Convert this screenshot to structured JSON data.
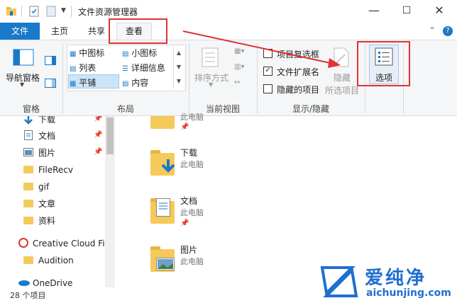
{
  "window": {
    "title": "文件资源管理器",
    "minimize": "—",
    "maximize": "☐",
    "close": "✕"
  },
  "tabs": [
    {
      "label": "文件"
    },
    {
      "label": "主页"
    },
    {
      "label": "共享"
    },
    {
      "label": "查看"
    }
  ],
  "ribbon": {
    "pane_group": {
      "label": "窗格",
      "nav_pane": "导航窗格"
    },
    "layout_group": {
      "label": "布局",
      "items": [
        "中图标",
        "小图标",
        "列表",
        "详细信息",
        "平铺",
        "内容"
      ],
      "selected": "平铺"
    },
    "current_view_group": {
      "label": "当前视图",
      "sort_by": "排序方式"
    },
    "show_hide_group": {
      "label": "显示/隐藏",
      "item_checkboxes": "项目复选框",
      "file_extensions": "文件扩展名",
      "hidden_items": "隐藏的项目",
      "hide_selected_line1": "隐藏",
      "hide_selected_line2": "所选项目"
    },
    "options": "选项",
    "help_chevron": "⌃",
    "help": "?"
  },
  "nav": {
    "items": [
      {
        "label": "下载",
        "pinned": true
      },
      {
        "label": "文档",
        "pinned": true
      },
      {
        "label": "图片",
        "pinned": true
      },
      {
        "label": "FileRecv"
      },
      {
        "label": "gif"
      },
      {
        "label": "文章"
      },
      {
        "label": "资料"
      },
      {
        "label": "Creative Cloud Fil"
      },
      {
        "label": "Audition"
      },
      {
        "label": "OneDrive"
      }
    ]
  },
  "content": {
    "items": [
      {
        "name": "此电脑"
      },
      {
        "name": "下载",
        "sub": "此电脑"
      },
      {
        "name": "文档",
        "sub": "此电脑"
      },
      {
        "name": "图片",
        "sub": "此电脑"
      }
    ]
  },
  "status": {
    "count": "28 个项目"
  },
  "watermark": {
    "brand": "爱纯净",
    "url": "aichunjing.com"
  },
  "colors": {
    "accent": "#1979ca",
    "annotation": "#e03232",
    "folder": "#f5c95a"
  }
}
